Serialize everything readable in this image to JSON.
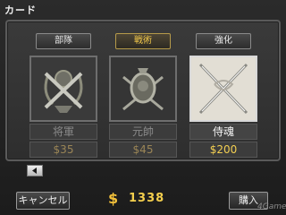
{
  "screen": {
    "title": "カード"
  },
  "tabs": [
    {
      "label": "部隊",
      "active": false
    },
    {
      "label": "戦術",
      "active": true
    },
    {
      "label": "強化",
      "active": false
    }
  ],
  "cards": [
    {
      "name": "将軍",
      "price": "$35",
      "icon": "crossed-swords-wreath-icon",
      "selected": false
    },
    {
      "name": "元帥",
      "price": "$45",
      "icon": "medal-crossed-swords-icon",
      "selected": false
    },
    {
      "name": "侍魂",
      "price": "$200",
      "icon": "crossed-katanas-icon",
      "selected": true
    }
  ],
  "footer": {
    "back_icon": "left-arrow-icon",
    "cancel_label": "キャンセル",
    "currency_symbol": "$",
    "money": "1338",
    "buy_label": "購入",
    "watermark": "4Gamer"
  },
  "colors": {
    "gold": "#f3cf52",
    "frame": "#5a5a5a",
    "selected_border": "#d8d8d8"
  }
}
